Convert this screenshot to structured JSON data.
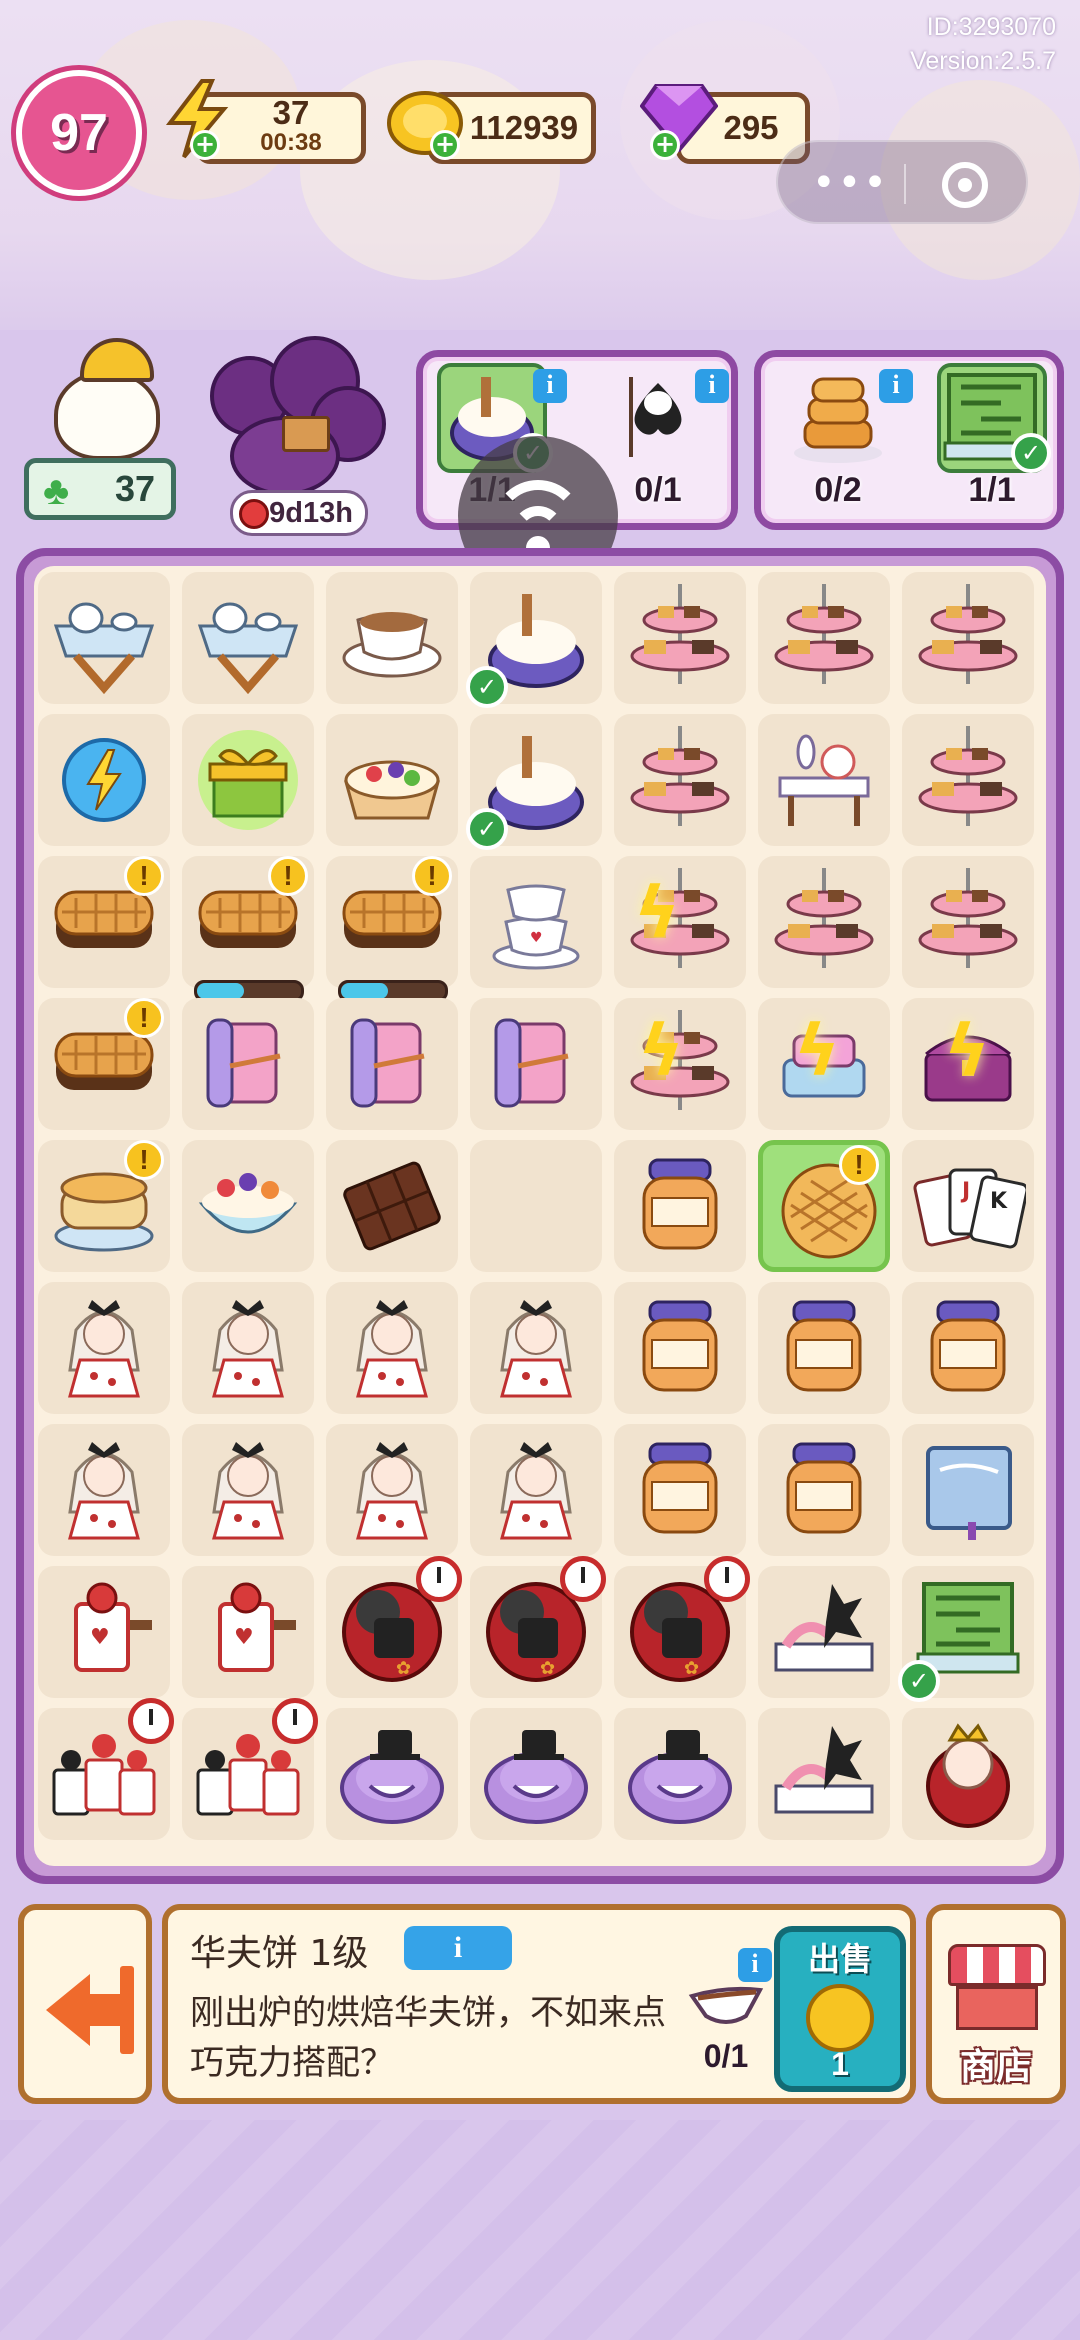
{
  "header": {
    "id_text": "ID:3293070",
    "version_text": "Version:2.5.7",
    "level": "97",
    "energy": "37",
    "energy_timer": "00:38",
    "coins": "112939",
    "gems": "295"
  },
  "character": {
    "clover_count": "37"
  },
  "event": {
    "timer": "9d13h"
  },
  "orders": [
    {
      "items": [
        {
          "icon": "whipped-cream-bowl",
          "count": "1/1",
          "done": true
        },
        {
          "icon": "spade-card-soldier",
          "count": "0/1",
          "done": false
        }
      ]
    },
    {
      "items": [
        {
          "icon": "pancake-stack",
          "count": "0/2",
          "done": false
        },
        {
          "icon": "hedge-maze-book",
          "count": "1/1",
          "done": true
        }
      ]
    }
  ],
  "board": {
    "rows": [
      [
        "tea-table",
        "tea-table",
        "coffee-cup",
        "whipped-cream-bowl",
        "cake-stand",
        "cake-stand",
        "cake-stand"
      ],
      [
        "energy-orb",
        "gift-box",
        "fruit-tart",
        "whipped-cream-bowl",
        "cake-stand",
        "tea-party-table",
        "cake-stand"
      ],
      [
        "waffle",
        "waffle",
        "waffle",
        "teacup-stack",
        "cake-stand",
        "cake-stand",
        "cake-stand"
      ],
      [
        "waffle",
        "paper-scroll",
        "paper-scroll",
        "paper-scroll",
        "cake-stand",
        "gift-pile",
        "treasure-chest"
      ],
      [
        "cheesecake",
        "fruit-bowl",
        "chocolate-bar",
        "empty",
        "jam-jar",
        "waffle-glow",
        "playing-cards"
      ],
      [
        "alice-doll",
        "alice-doll",
        "alice-doll",
        "alice-doll",
        "jam-jar",
        "jam-jar",
        "jam-jar"
      ],
      [
        "alice-doll",
        "alice-doll",
        "alice-doll",
        "alice-doll",
        "jam-jar",
        "jam-jar",
        "storybook"
      ],
      [
        "card-soldier",
        "card-soldier",
        "queen-of-hearts",
        "queen-of-hearts",
        "queen-of-hearts",
        "flamingo-book",
        "maze-book"
      ],
      [
        "card-army",
        "card-army",
        "cheshire-cat",
        "cheshire-cat",
        "cheshire-cat",
        "flamingo-book",
        "red-queen"
      ]
    ],
    "progress": {
      "waffle_r2c1": 0.45,
      "waffle_r2c2": 0.45
    }
  },
  "info_panel": {
    "title": "华夫饼 1级",
    "info_button": "i",
    "description": "刚出炉的烘焙华夫饼，不如来点巧克力搭配？",
    "requirement_count": "0/1",
    "sell_label": "出售",
    "sell_value": "1"
  },
  "shop": {
    "label": "商店"
  },
  "colors": {
    "board_border": "#8c4ca4",
    "panel_border": "#b0702e",
    "sell_button": "#27b0c0"
  }
}
